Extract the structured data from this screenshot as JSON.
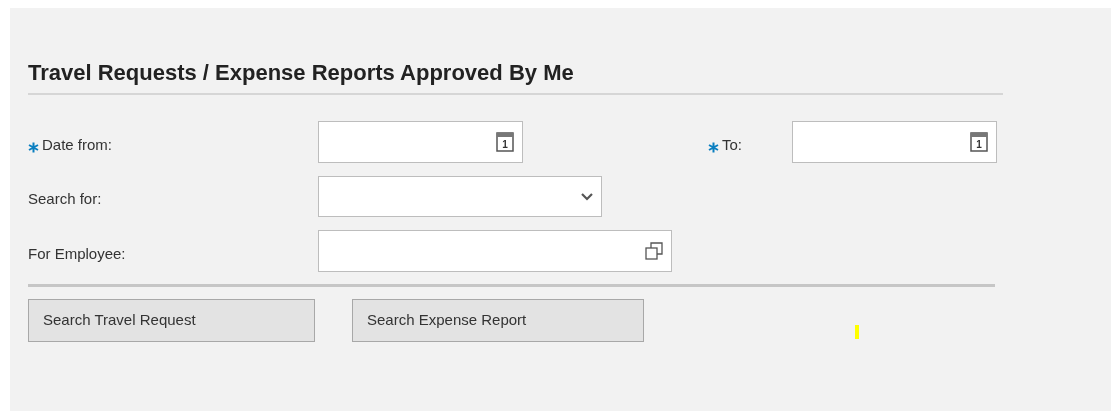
{
  "title": "Travel Requests / Expense Reports Approved By Me",
  "rows": [
    {
      "fields": [
        {
          "label": "Date from:",
          "required": true,
          "kind": "date",
          "calendar_day": "1"
        },
        {
          "label": "To:",
          "required": true,
          "kind": "date",
          "calendar_day": "1"
        }
      ]
    },
    {
      "fields": [
        {
          "label": "Search for:",
          "required": false,
          "kind": "select"
        }
      ]
    },
    {
      "fields": [
        {
          "label": "For Employee:",
          "required": false,
          "kind": "valuehelp"
        }
      ]
    }
  ],
  "buttons": [
    "Search Travel Request",
    "Search Expense Report"
  ]
}
